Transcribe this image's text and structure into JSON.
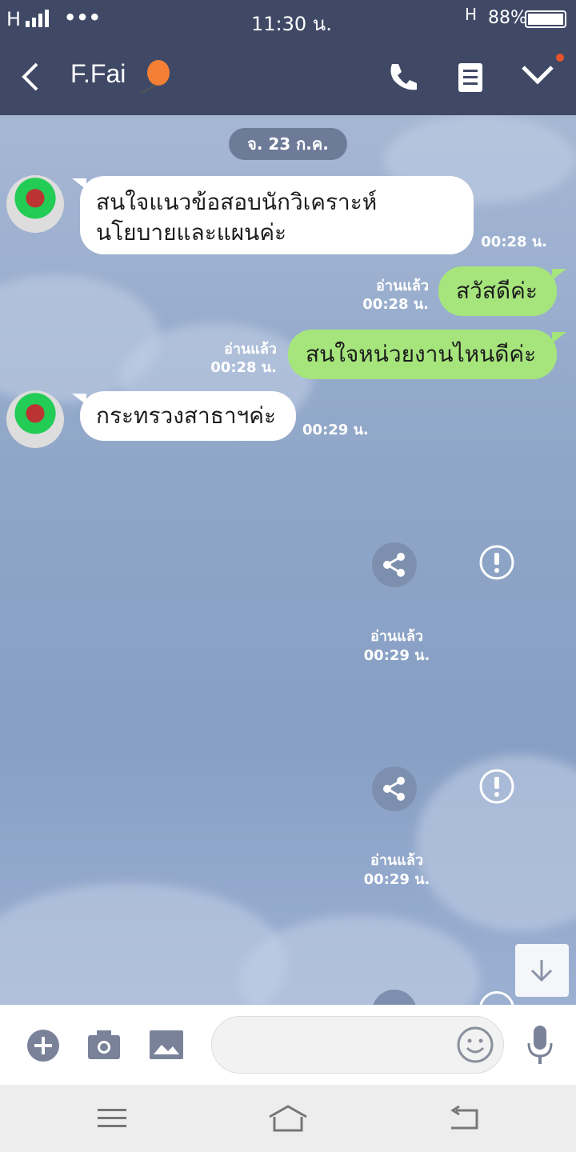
{
  "status_bar": {
    "network_left": "H",
    "more": "•••",
    "time": "11:30 น.",
    "network_right": "H",
    "battery": "88%"
  },
  "header": {
    "contact_name": "F.Fai"
  },
  "chat": {
    "date_pill": "จ. 23 ก.ค.",
    "messages": [
      {
        "text_line1": "สนใจแนวข้อสอบนักวิเคราะห์",
        "text_line2": "นโยบายและแผนค่ะ",
        "time": "00:28 น."
      },
      {
        "text": "สวัสดีค่ะ",
        "read": "อ่านแล้ว",
        "time": "00:28 น."
      },
      {
        "text": "สนใจหน่วยงานไหนดีค่ะ",
        "read": "อ่านแล้ว",
        "time": "00:28 น."
      },
      {
        "text": "กระทรวงสาธาฯค่ะ",
        "time": "00:29 น."
      }
    ],
    "media_rows": [
      {
        "read": "อ่านแล้ว",
        "time": "00:29 น."
      },
      {
        "read": "อ่านแล้ว",
        "time": "00:29 น."
      }
    ]
  },
  "colors": {
    "header_bg": "#3f4966",
    "outgoing_bubble": "#a5e57c",
    "incoming_bubble": "#ffffff",
    "chat_bg": "#8da3c6"
  }
}
